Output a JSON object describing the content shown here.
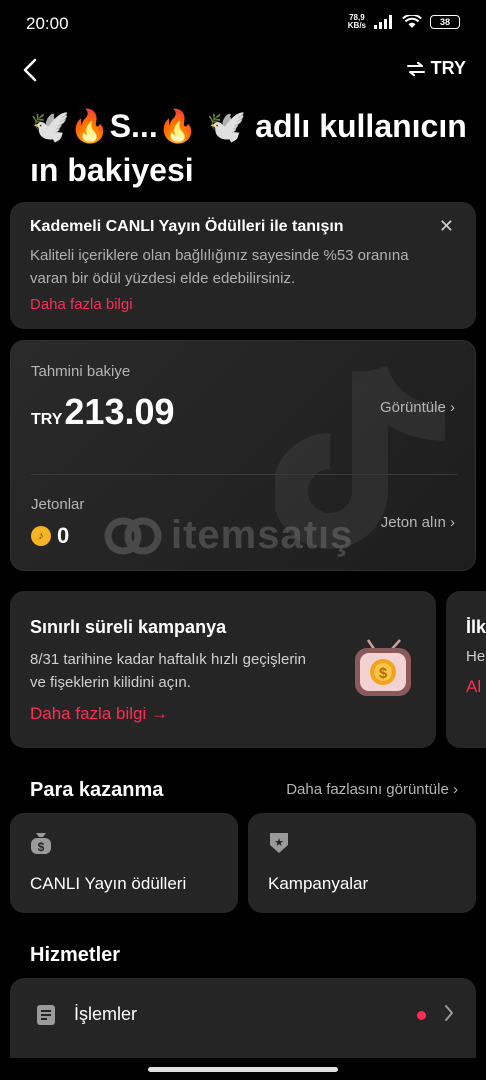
{
  "status_bar": {
    "time": "20:00",
    "net_speed_value": "78,9",
    "net_speed_unit": "KB/s",
    "battery": "38"
  },
  "nav": {
    "currency": "TRY"
  },
  "title": "🕊️🔥S...🔥 🕊️ adlı kullanıcının bakiyesi",
  "promo": {
    "title": "Kademeli CANLI Yayın Ödülleri ile tanışın",
    "body": "Kaliteli içeriklere olan bağlılığınız sayesinde %53 oranına varan bir ödül yüzdesi elde edebilirsiniz.",
    "link": "Daha fazla bilgi"
  },
  "balance": {
    "label": "Tahmini bakiye",
    "currency": "TRY",
    "value": "213.09",
    "view_label": "Görüntüle ›",
    "coins_label": "Jetonlar",
    "coins_value": "0",
    "get_coins_label": "Jeton alın ›",
    "watermark": "itemsatış"
  },
  "campaign": {
    "title": "Sınırlı süreli kampanya",
    "body": "8/31 tarihine kadar haftalık hızlı geçişlerin ve fişeklerin kilidini açın.",
    "link": "Daha fazla bilgi →"
  },
  "campaign_peek": {
    "title": "İlk",
    "body": "He",
    "link": "Al"
  },
  "monetization": {
    "title": "Para kazanma",
    "see_more": "Daha fazlasını görüntüle ›",
    "tiles": [
      {
        "label": "CANLI Yayın ödülleri",
        "icon": "money-bag-icon"
      },
      {
        "label": "Kampanyalar",
        "icon": "badge-star-icon"
      }
    ]
  },
  "services": {
    "title": "Hizmetler",
    "items": [
      {
        "label": "İşlemler",
        "icon": "document-icon"
      }
    ]
  },
  "colors": {
    "accent": "#fe2c55",
    "card": "#252525",
    "background": "#000000"
  }
}
